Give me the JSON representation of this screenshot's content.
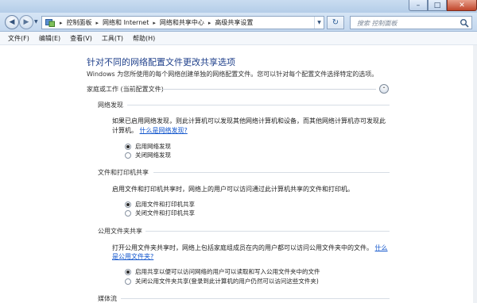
{
  "window": {
    "title": "",
    "caption": {
      "minimize": "–",
      "maximize": "□",
      "close": "✕"
    }
  },
  "navigation": {
    "back_symbol": "◀",
    "forward_symbol": "▶",
    "crumbs": [
      "控制面板",
      "网络和 Internet",
      "网络和共享中心",
      "高级共享设置"
    ],
    "separator": "▸",
    "refresh_symbol": "↻",
    "search_placeholder": "搜索 控制面板"
  },
  "menu": [
    "文件(F)",
    "编辑(E)",
    "查看(V)",
    "工具(T)",
    "帮助(H)"
  ],
  "page": {
    "title": "针对不同的网络配置文件更改共享选项",
    "subtitle": "Windows 为您所使用的每个网络创建单独的网络配置文件。您可以针对每个配置文件选择特定的选项。",
    "profile": {
      "title": "家庭或工作 (当前配置文件)",
      "collapse_symbol": "⌃"
    },
    "sections": {
      "discovery": {
        "title": "网络发现",
        "text_line1": "如果已启用网络发现，则此计算机可以发现其他网络计算机和设备，而其他网络计算机亦可发现此",
        "text_line2": "计算机。",
        "link": "什么是网络发现?",
        "options": [
          "启用网络发现",
          "关闭网络发现"
        ],
        "selected": 0
      },
      "file_printer": {
        "title": "文件和打印机共享",
        "text": "启用文件和打印机共享时，网络上的用户可以访问通过此计算机共享的文件和打印机。",
        "options": [
          "启用文件和打印机共享",
          "关闭文件和打印机共享"
        ],
        "selected": 0
      },
      "public_folder": {
        "title": "公用文件夹共享",
        "text_line1": "打开公用文件夹共享时，网络上包括家庭组成员在内的用户都可以访问公用文件夹中的文件。",
        "link_part1": "什么",
        "link_part2": "是公用文件夹?",
        "options": [
          "启用共享以便可以访问网络的用户可以读取和写入公用文件夹中的文件",
          "关闭公用文件夹共享(登录到此计算机的用户仍然可以访问这些文件夹)"
        ],
        "selected": 0
      },
      "media": {
        "title": "媒体流"
      }
    }
  },
  "colors": {
    "title_blue": "#1e3f8a",
    "link_blue": "#1155cc",
    "chrome_blue": "#c3d7ee"
  }
}
